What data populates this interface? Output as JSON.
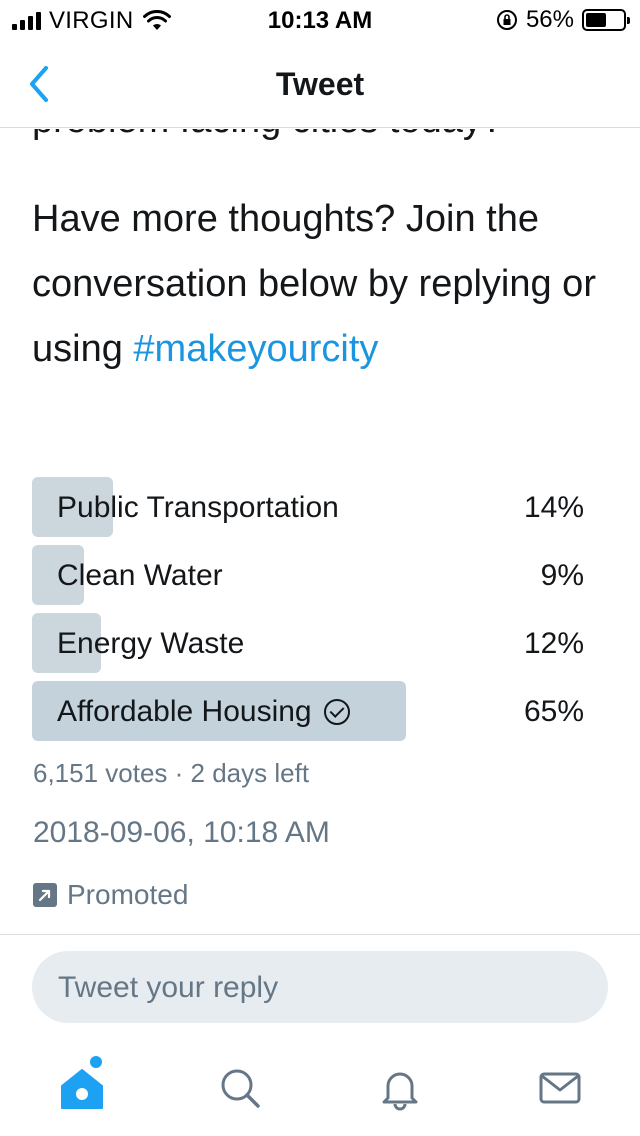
{
  "status_bar": {
    "carrier": "VIRGIN",
    "time": "10:13 AM",
    "battery": "56%",
    "battery_level": 0.56
  },
  "nav": {
    "title": "Tweet",
    "back_icon": "chevron-left-icon"
  },
  "tweet": {
    "partial_line": "problem facing cities today?",
    "body": "Have more thoughts? Join the conversation below by replying or using ",
    "hashtag": "#makeyourcity"
  },
  "poll": {
    "options": [
      {
        "label": "Public Transportation",
        "percent": "14%",
        "value": 14,
        "winner": false
      },
      {
        "label": "Clean Water",
        "percent": "9%",
        "value": 9,
        "winner": false
      },
      {
        "label": "Energy Waste",
        "percent": "12%",
        "value": 12,
        "winner": false
      },
      {
        "label": "Affordable Housing",
        "percent": "65%",
        "value": 65,
        "winner": true
      }
    ],
    "meta": "6,151 votes · 2 days left"
  },
  "timestamp": "2018-09-06, 10:18 AM",
  "promoted_label": "Promoted",
  "reply": {
    "placeholder": "Tweet your reply"
  },
  "tabs": [
    {
      "name": "home",
      "icon": "home-icon",
      "active": true
    },
    {
      "name": "search",
      "icon": "search-icon",
      "active": false
    },
    {
      "name": "notifications",
      "icon": "bell-icon",
      "active": false
    },
    {
      "name": "messages",
      "icon": "mail-icon",
      "active": false
    }
  ],
  "colors": {
    "accent": "#1da1f2",
    "hashtag": "#1b95e0",
    "muted": "#657786",
    "poll_bar": "#ccd6dd"
  }
}
